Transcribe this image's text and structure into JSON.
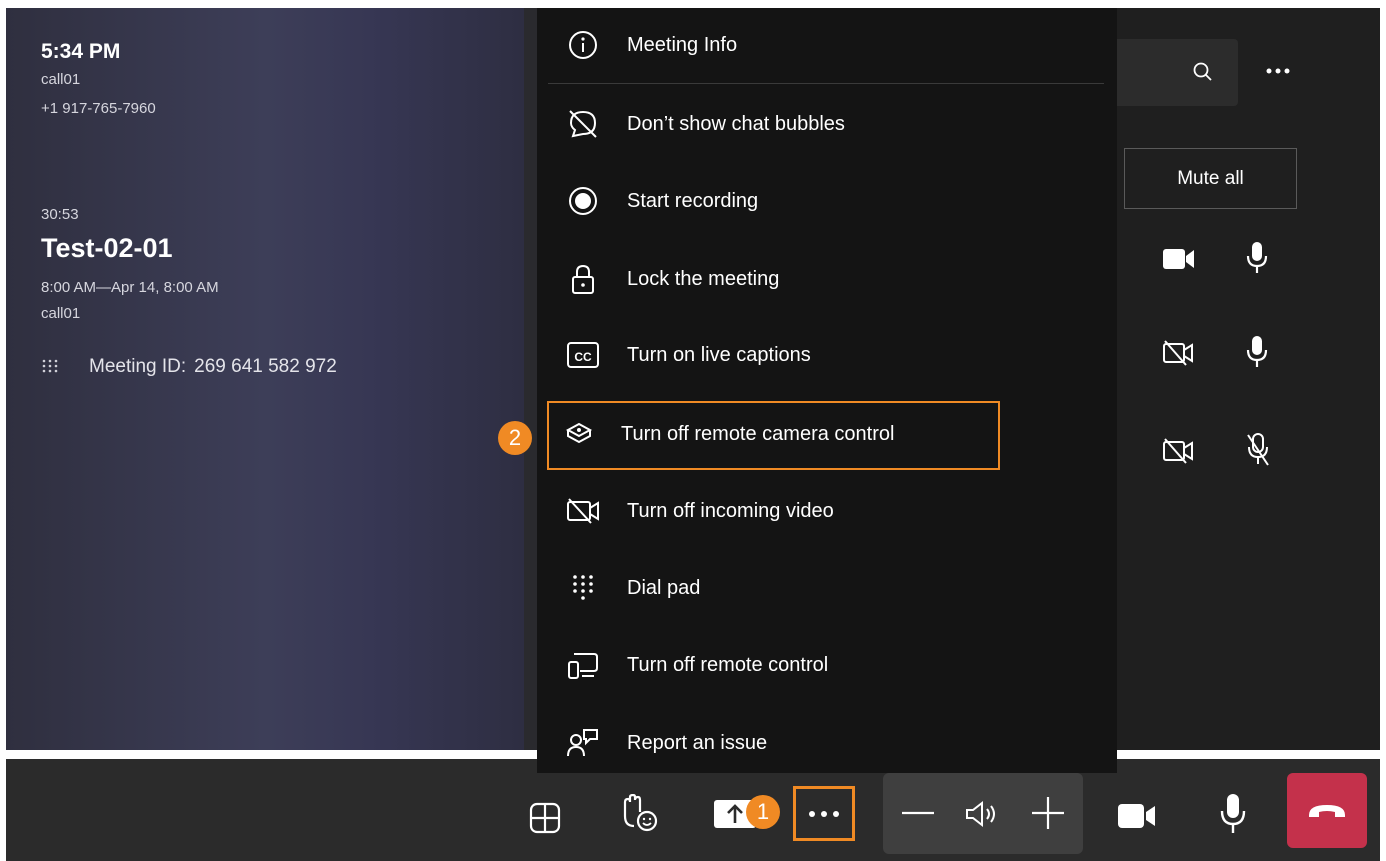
{
  "meeting": {
    "time": "5:34 PM",
    "device": "call01",
    "phone": "+1 917-765-7960",
    "elapsed": "30:53",
    "title": "Test-02-01",
    "schedule": "8:00 AM—Apr 14, 8:00 AM",
    "organizer": "call01",
    "meeting_id_label": "Meeting ID:",
    "meeting_id": "269 641 582 972"
  },
  "menu": {
    "items": [
      {
        "label": "Meeting Info",
        "icon": "info-icon"
      },
      {
        "label": "Don’t show chat bubbles",
        "icon": "chat-bubble-off-icon"
      },
      {
        "label": "Start recording",
        "icon": "record-icon"
      },
      {
        "label": "Lock the meeting",
        "icon": "lock-icon"
      },
      {
        "label": "Turn on live captions",
        "icon": "captions-icon"
      },
      {
        "label": "Turn off remote camera control",
        "icon": "camera-control-icon"
      },
      {
        "label": "Turn off incoming video",
        "icon": "video-off-icon"
      },
      {
        "label": "Dial pad",
        "icon": "dialpad-icon"
      },
      {
        "label": "Turn off remote control",
        "icon": "remote-control-icon"
      },
      {
        "label": "Report an issue",
        "icon": "report-issue-icon"
      }
    ]
  },
  "participants": {
    "mute_all_label": "Mute all"
  },
  "annotations": {
    "step1": "1",
    "step2": "2",
    "color": "#f08a24"
  },
  "colors": {
    "hangup": "#c4314b",
    "menu_bg": "#141414"
  }
}
